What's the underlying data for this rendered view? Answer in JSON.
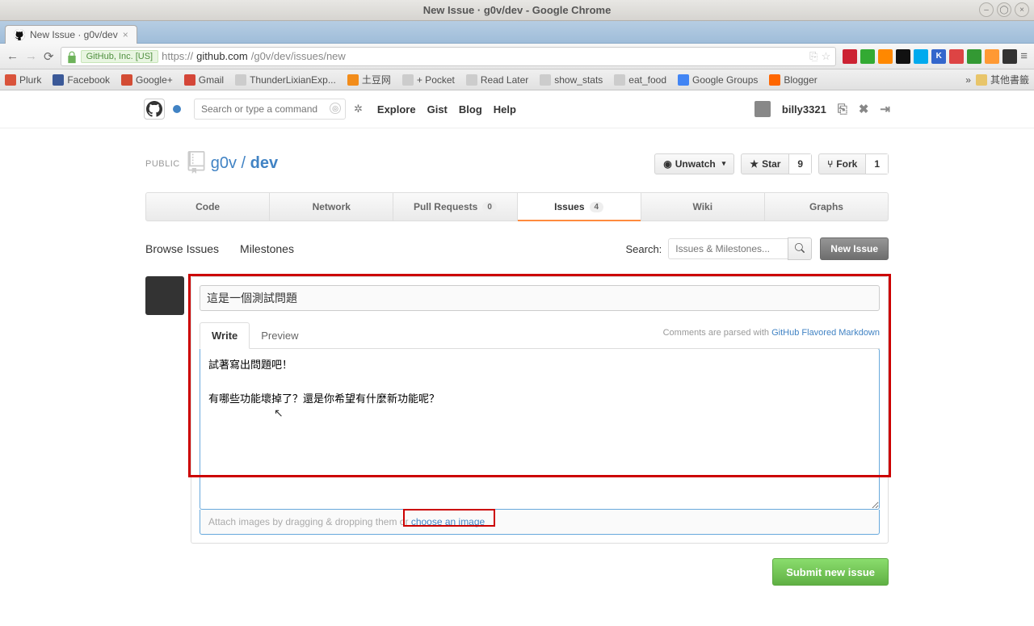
{
  "window": {
    "title": "New Issue ·  g0v/dev - Google Chrome"
  },
  "tab": {
    "title": "New Issue ·  g0v/dev"
  },
  "omnibox": {
    "ssl_label": "GitHub, Inc. [US]",
    "url_host": "https://",
    "url_domain": "github.com",
    "url_path": "/g0v/dev/issues/new"
  },
  "bookmarks": [
    {
      "label": "Plurk",
      "color": "#d9533b"
    },
    {
      "label": "Facebook",
      "color": "#3b5998"
    },
    {
      "label": "Google+",
      "color": "#d34c34"
    },
    {
      "label": "Gmail",
      "color": "#d44638"
    },
    {
      "label": "ThunderLixianExp...",
      "color": "#ccc"
    },
    {
      "label": "土豆网",
      "color": "#f28c1a"
    },
    {
      "label": "+ Pocket",
      "color": "#ccc"
    },
    {
      "label": "Read Later",
      "color": "#ccc"
    },
    {
      "label": "show_stats",
      "color": "#ccc"
    },
    {
      "label": "eat_food",
      "color": "#ccc"
    },
    {
      "label": "Google Groups",
      "color": "#4285f4"
    },
    {
      "label": "Blogger",
      "color": "#ff6600"
    }
  ],
  "bookmark_overflow": "»",
  "bookmark_folder": "其他書籤",
  "gh": {
    "search_placeholder": "Search or type a command",
    "nav": [
      "Explore",
      "Gist",
      "Blog",
      "Help"
    ],
    "username": "billy3321"
  },
  "repo": {
    "visibility": "PUBLIC",
    "owner": "g0v",
    "name": "dev",
    "unwatch": "Unwatch",
    "star": "Star",
    "star_count": "9",
    "fork": "Fork",
    "fork_count": "1"
  },
  "repotabs": {
    "code": "Code",
    "network": "Network",
    "pulls": "Pull Requests",
    "pulls_count": "0",
    "issues": "Issues",
    "issues_count": "4",
    "wiki": "Wiki",
    "graphs": "Graphs"
  },
  "issuesnav": {
    "browse": "Browse Issues",
    "milestones": "Milestones",
    "search_label": "Search:",
    "search_placeholder": "Issues & Milestones...",
    "new_issue": "New Issue"
  },
  "form": {
    "title_value": "這是一個測試問題",
    "tab_write": "Write",
    "tab_preview": "Preview",
    "md_hint_prefix": "Comments are parsed with ",
    "md_hint_link": "GitHub Flavored Markdown",
    "body_value": "試著寫出問題吧！\n\n有哪些功能壞掉了？還是你希望有什麼新功能呢？",
    "drag_prefix": "Attach images by dragging & dropping them or ",
    "drag_link": "choose an image",
    "submit": "Submit new issue"
  }
}
